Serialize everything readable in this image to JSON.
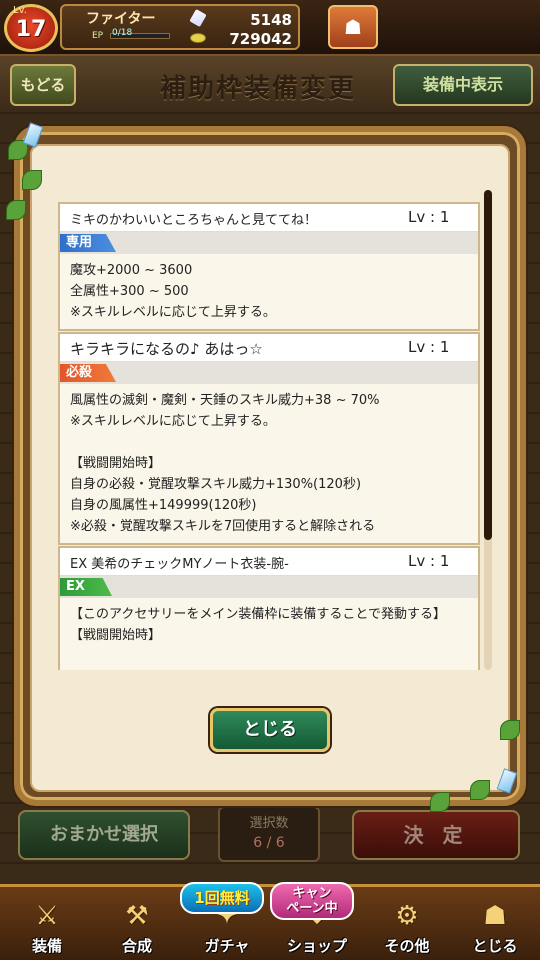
{
  "status": {
    "level_label": "Lv.",
    "level": "17",
    "player_name": "ファイター",
    "ep_label": "EP",
    "ep_value": "0/18",
    "gems": "5148",
    "coins": "729042"
  },
  "subheader": {
    "back_label": "もどる",
    "title": "補助枠装備変更",
    "equipped_label": "装備中表示"
  },
  "modal": {
    "cards": [
      {
        "title": "ミキのかわいいところちゃんと見ててね！",
        "level": "Lv : 1",
        "type": "専用",
        "lines": [
          "魔攻+2000 ~ 3600",
          "全属性+300 ~ 500",
          "※スキルレベルに応じて上昇する。"
        ]
      },
      {
        "title": "キラキラになるの♪ あはっ☆",
        "level": "Lv : 1",
        "type": "必殺",
        "lines": [
          "風属性の滅剣・魔剣・天錘のスキル威力+38 ~ 70%",
          "※スキルレベルに応じて上昇する。",
          "",
          "【戦闘開始時】",
          "自身の必殺・覚醒攻撃スキル威力+130%(120秒)",
          "自身の風属性+149999(120秒)",
          "※必殺・覚醒攻撃スキルを7回使用すると解除される"
        ]
      },
      {
        "title": "EX 美希のチェックMYノート衣装-腕-",
        "level": "Lv : 1",
        "type": "EX",
        "lines": [
          "【このアクセサリーをメイン装備枠に装備することで発動する】",
          "【戦闘開始時】"
        ]
      }
    ],
    "close_label": "とじる"
  },
  "controls": {
    "omakase_label": "おまかせ選択",
    "selection_label": "選択数",
    "selection_count": "6 / 6",
    "decide_label": "決 定"
  },
  "nav": {
    "items": [
      {
        "label": "装備",
        "icon": "sword-shield-icon"
      },
      {
        "label": "合成",
        "icon": "hammer-icon"
      },
      {
        "label": "ガチャ",
        "icon": "gacha-icon"
      },
      {
        "label": "ショップ",
        "icon": "shop-icon"
      },
      {
        "label": "その他",
        "icon": "gear-icon"
      },
      {
        "label": "とじる",
        "icon": "close-gold-icon"
      }
    ],
    "gacha_badge": "1回無料",
    "shop_badge_line1": "キャン",
    "shop_badge_line2": "ペーン中"
  },
  "colors": {
    "accent_gold": "#d7ad62",
    "dialog_bg": "#f4ead3",
    "tag_exclusive": "#2f6fc9",
    "tag_special": "#e2562a",
    "tag_ex": "#2f9a3a"
  }
}
